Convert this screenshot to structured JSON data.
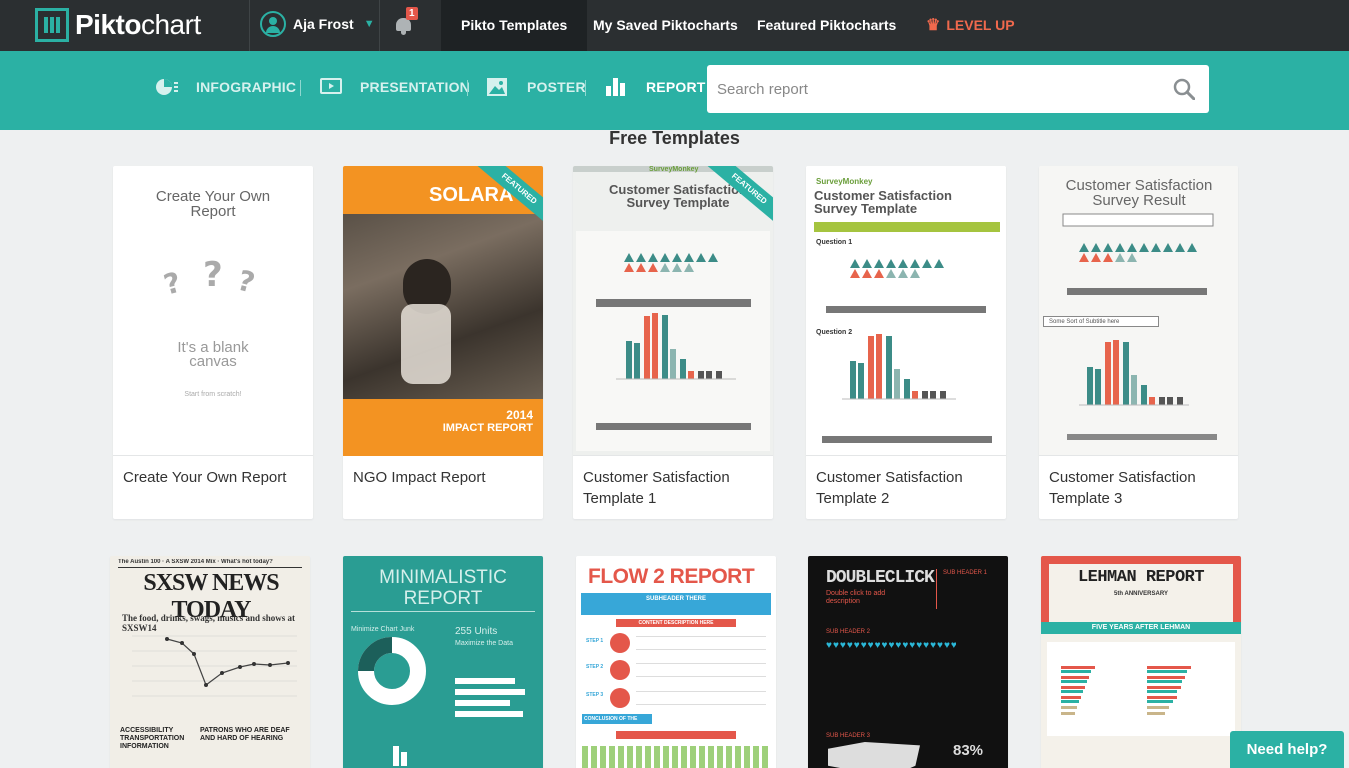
{
  "app": {
    "logo_bold": "Pikto",
    "logo_thin": "chart"
  },
  "user": {
    "name": "Aja Frost"
  },
  "notifications": {
    "count": "1"
  },
  "nav": {
    "items": [
      "Pikto Templates",
      "My Saved Piktocharts",
      "Featured Piktocharts"
    ],
    "levelup": "LEVEL UP"
  },
  "categories": [
    "INFOGRAPHIC",
    "PRESENTATION",
    "POSTER",
    "REPORT"
  ],
  "search": {
    "placeholder": "Search report"
  },
  "section": {
    "title": "Free Templates"
  },
  "cards": [
    {
      "label": "Create Your Own Report",
      "thumb": {
        "title": "Create Your Own Report",
        "blank": "It's a blank canvas",
        "hint": "Start from scratch!"
      }
    },
    {
      "label": "NGO Impact Report",
      "featured": "FEATURED",
      "thumb": {
        "title": "SOLARA",
        "year": "2014",
        "subtitle": "IMPACT REPORT"
      }
    },
    {
      "label": "Customer Satisfaction Template 1",
      "featured": "FEATURED",
      "thumb": {
        "brand": "SurveyMonkey",
        "title": "Customer Satisfaction Survey Template"
      }
    },
    {
      "label": "Customer Satisfaction Template 2",
      "thumb": {
        "brand": "SurveyMonkey",
        "title": "Customer Satisfaction Survey Template",
        "q1": "Question 1",
        "q2": "Question 2"
      }
    },
    {
      "label": "Customer Satisfaction Template 3",
      "thumb": {
        "title": "Customer Satisfaction Survey Result",
        "sub": "Some Sort of Subtitle here"
      }
    }
  ],
  "row2": [
    {
      "title": "SXSW NEWS TODAY",
      "top": "The Austin 100 · A SXSW 2014 Mix · What's hot today?",
      "lead": "The food, drinks, swags, musics and shows at SXSW14",
      "h1": "ACCESSIBILITY TRANSPORTATION INFORMATION",
      "h2": "PATRONS WHO ARE DEAF AND HARD OF HEARING"
    },
    {
      "title": "MINIMALISTIC REPORT",
      "left": "Minimize Chart Junk",
      "right": "255 Units",
      "right2": "Maximize the Data"
    },
    {
      "title": "FLOW 2 REPORT",
      "sub": "SUBHEADER THERE",
      "content": "CONTENT DESCRIPTION HERE",
      "steps": [
        "STEP 1",
        "STEP 2",
        "STEP 3"
      ],
      "conclusion": "CONCLUSION OF THE FLOW:"
    },
    {
      "title": "DOUBLECLICK",
      "sub": "Double click to add description",
      "h1": "SUB HEADER 1",
      "h2": "SUB HEADER 2",
      "h3": "SUB HEADER 3",
      "pct": "83%"
    },
    {
      "title": "LEHMAN REPORT",
      "sub": "5th ANNIVERSARY",
      "band": "FIVE YEARS AFTER LEHMAN"
    }
  ],
  "help": {
    "label": "Need help?"
  }
}
